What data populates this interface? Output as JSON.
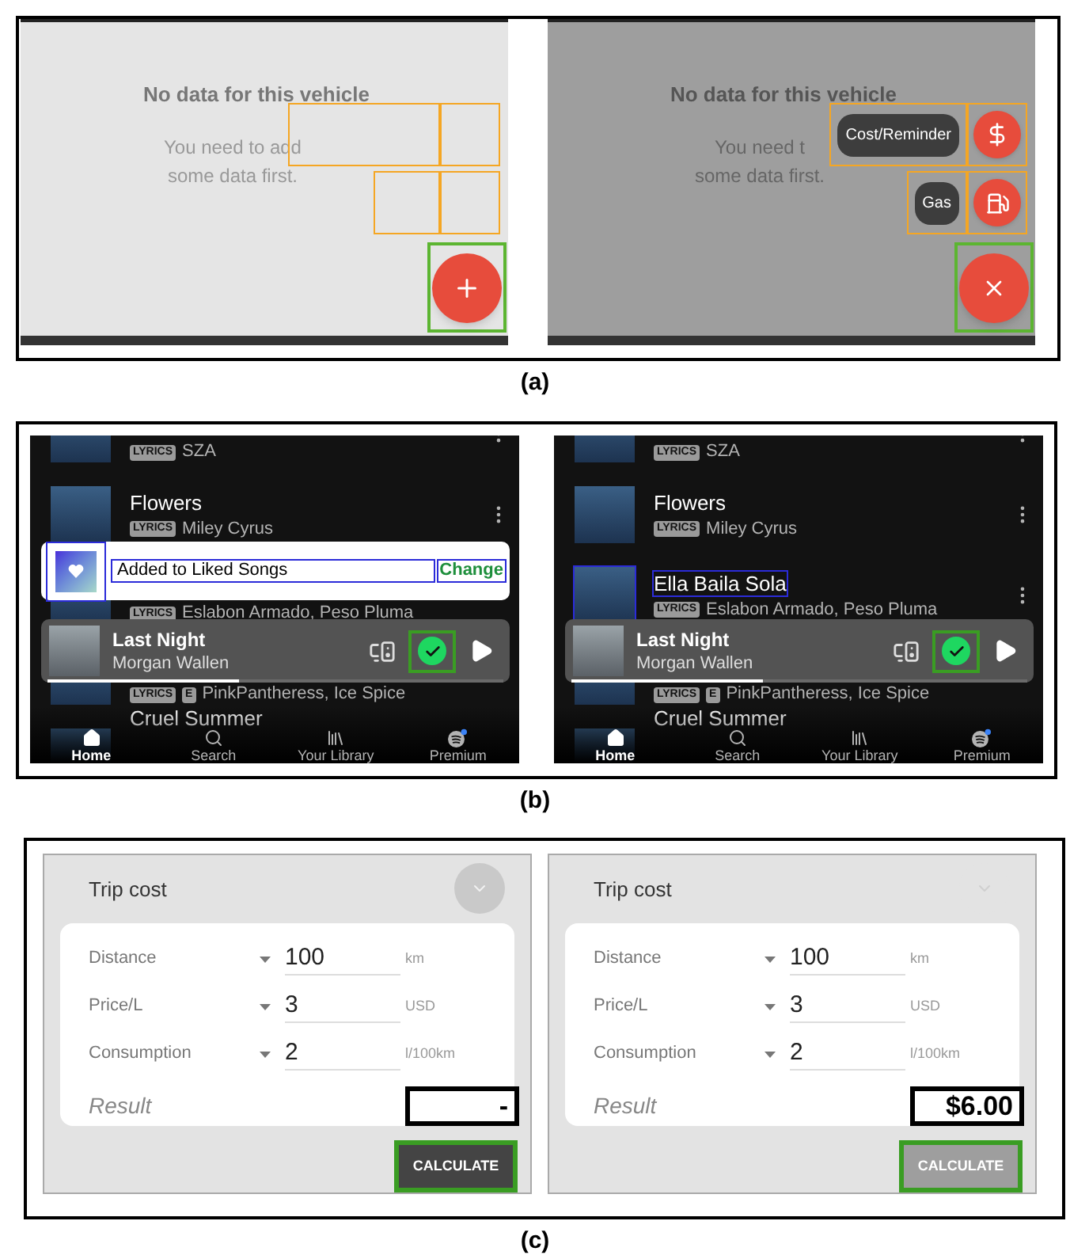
{
  "figures": [
    {
      "label": "(a)",
      "kind": "vehicle",
      "screens": [
        {
          "title": "No data for this vehicle",
          "message_lines": [
            "You need to add",
            "some data first."
          ],
          "menu_open": false
        },
        {
          "title": "No data for this vehicle",
          "message_lines": [
            "You need t",
            "some data first."
          ],
          "menu_open": true,
          "menu": [
            {
              "label": "Cost/Reminder",
              "kind": "cost"
            },
            {
              "label": "Gas",
              "kind": "gas"
            }
          ]
        }
      ]
    },
    {
      "label": "(b)",
      "kind": "music",
      "screens": [
        {
          "songs": [
            {
              "badges": [
                "LYRICS"
              ],
              "artist": "SZA",
              "outlined": false,
              "more": true
            },
            {
              "title": "Flowers",
              "badges": [
                "LYRICS"
              ],
              "artist": "Miley Cyrus",
              "outlined": false,
              "more": true
            },
            {
              "badges": [
                "LYRICS"
              ],
              "artist": "Eslabon Armado, Peso Pluma",
              "outlined": false,
              "more": false
            },
            {
              "badges": [
                "LYRICS",
                "E"
              ],
              "artist": "PinkPantheress, Ice Spice",
              "outlined": false,
              "more": false
            },
            {
              "title": "Cruel Summer",
              "outlined": false,
              "more": false
            }
          ],
          "toast": {
            "text": "Added to Liked Songs",
            "action": "Change"
          },
          "now_playing": {
            "title": "Last Night",
            "artist": "Morgan Wallen",
            "liked": true,
            "level": 0.42
          },
          "nav": [
            {
              "label": "Home",
              "kind": "home",
              "selected": true
            },
            {
              "label": "Search",
              "kind": "search",
              "selected": false
            },
            {
              "label": "Your Library",
              "kind": "library",
              "selected": false
            },
            {
              "label": "Premium",
              "kind": "premium",
              "selected": false
            }
          ]
        },
        {
          "songs": [
            {
              "badges": [
                "LYRICS"
              ],
              "artist": "SZA",
              "outlined": false,
              "more": true
            },
            {
              "title": "Flowers",
              "badges": [
                "LYRICS"
              ],
              "artist": "Miley Cyrus",
              "outlined": false,
              "more": true
            },
            {
              "title": "Ella Baila Sola",
              "badges": [
                "LYRICS"
              ],
              "artist": "Eslabon Armado, Peso Pluma",
              "outlined": true,
              "more": true
            },
            {
              "badges": [
                "LYRICS",
                "E"
              ],
              "artist": "PinkPantheress, Ice Spice",
              "outlined": false,
              "more": false
            },
            {
              "title": "Cruel Summer",
              "outlined": false,
              "more": false
            }
          ],
          "now_playing": {
            "title": "Last Night",
            "artist": "Morgan Wallen",
            "liked": true,
            "level": 0.42
          },
          "nav": [
            {
              "label": "Home",
              "kind": "home",
              "selected": true
            },
            {
              "label": "Search",
              "kind": "search",
              "selected": false
            },
            {
              "label": "Your Library",
              "kind": "library",
              "selected": false
            },
            {
              "label": "Premium",
              "kind": "premium",
              "selected": false
            }
          ]
        }
      ]
    },
    {
      "label": "(c)",
      "kind": "trip",
      "screens": [
        {
          "title": "Trip cost",
          "toggle_highlighted": true,
          "fields": [
            {
              "label": "Distance",
              "value": "100",
              "unit": "km"
            },
            {
              "label": "Price/L",
              "value": "3",
              "unit": "USD"
            },
            {
              "label": "Consumption",
              "value": "2",
              "unit": "l/100km"
            }
          ],
          "result_label": "Result",
          "result": "-",
          "calculate": {
            "label": "CALCULATE",
            "disabled": false
          }
        },
        {
          "title": "Trip cost",
          "toggle_highlighted": false,
          "fields": [
            {
              "label": "Distance",
              "value": "100",
              "unit": "km"
            },
            {
              "label": "Price/L",
              "value": "3",
              "unit": "USD"
            },
            {
              "label": "Consumption",
              "value": "2",
              "unit": "l/100km"
            }
          ],
          "result_label": "Result",
          "result": "$6.00",
          "calculate": {
            "label": "CALCULATE",
            "disabled": true
          }
        }
      ]
    }
  ]
}
